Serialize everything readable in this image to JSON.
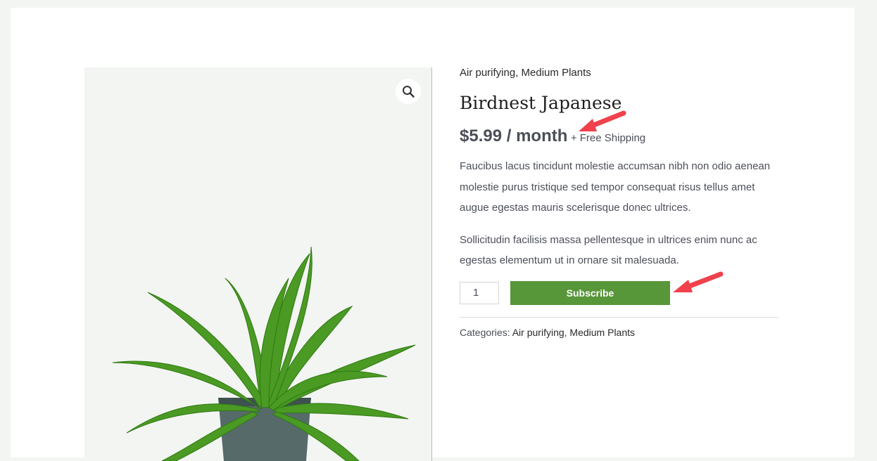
{
  "product": {
    "categories_top": [
      "Air purifying",
      "Medium Plants"
    ],
    "title": "Birdnest Japanese",
    "price": "$5.99 / month",
    "shipping": "+ Free Shipping",
    "description": [
      "Faucibus lacus tincidunt molestie accumsan nibh non odio aenean molestie purus tristique sed tempor consequat risus tellus amet augue egestas mauris scelerisque donec ultrices.",
      "Sollicitudin facilisis massa pellentesque in ultrices enim nunc ac egestas elementum ut in ornare sit malesuada."
    ],
    "quantity": "1",
    "subscribe_label": "Subscribe",
    "meta_label": "Categories:",
    "categories_meta": [
      "Air purifying",
      "Medium Plants"
    ]
  },
  "gallery": {
    "zoom_icon": "magnifier-icon",
    "image": "bird-nest-fern-plant"
  },
  "annotations": {
    "arrow_color": "#f0414c",
    "arrow_icon": "red-arrow"
  },
  "colors": {
    "accent": "#58963a",
    "page_bg": "#f3f5f2",
    "text": "#4b4f58"
  }
}
